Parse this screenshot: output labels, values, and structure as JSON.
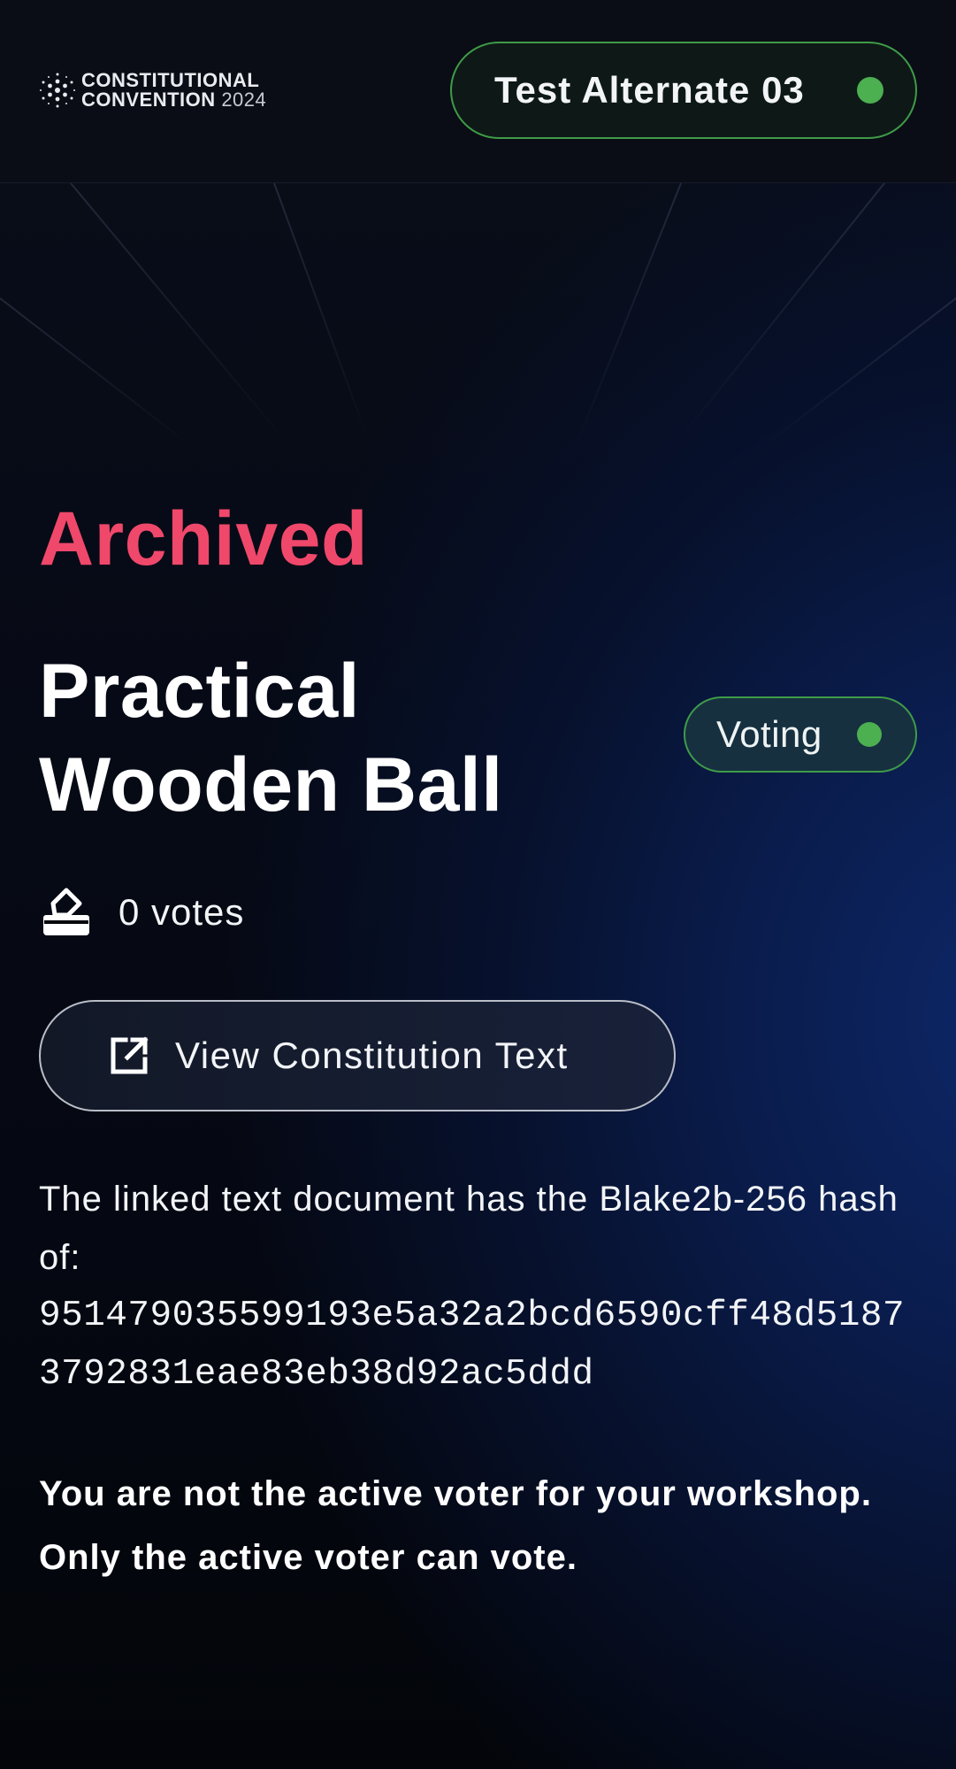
{
  "header": {
    "logo": {
      "line1": "CONSTITUTIONAL",
      "line2": "CONVENTION",
      "year": "2024"
    },
    "user": {
      "name": "Test Alternate 03",
      "status_color": "#4caf50"
    }
  },
  "proposal": {
    "status": "Archived",
    "title": "Practical Wooden Ball",
    "phase_badge": "Voting",
    "votes_label": "0 votes",
    "view_button_label": "View Constitution Text",
    "hash_intro": "The linked text document has the Blake2b-256 hash of:",
    "hash_value": "951479035599193e5a32a2bcd6590cff48d51873792831eae83eb38d92ac5ddd",
    "notice": "You are not the active voter for your workshop. Only the active voter can vote."
  },
  "colors": {
    "archived_accent": "#f0486b",
    "success_green": "#4caf50",
    "brand_blue": "#0d2768"
  },
  "icons": {
    "logo": "cardano-logo-icon",
    "votes": "ballot-box-icon",
    "external_link": "external-link-icon",
    "status": "status-dot-icon"
  }
}
